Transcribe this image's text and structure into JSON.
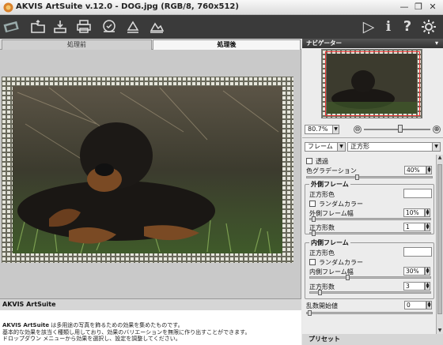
{
  "window": {
    "title": "AKVIS ArtSuite v.12.0 - DOG.jpg (RGB/8, 760x512)",
    "minimize_glyph": "—",
    "restore_glyph": "❐",
    "close_glyph": "✕"
  },
  "toolbar": {
    "icons": [
      "open-icon",
      "save-icon",
      "print-icon",
      "share-icon",
      "batch-icon",
      "settings-extra-icon",
      "run-icon",
      "info-icon",
      "help-icon",
      "preferences-icon"
    ],
    "run_glyph": "▷",
    "info_glyph": "i",
    "help_glyph": "?"
  },
  "tabs": {
    "before_label": "処理前",
    "after_label": "処理後"
  },
  "help": {
    "heading": "AKVIS ArtSuite",
    "strong": "AKVIS ArtSuite",
    "line1_rest": " は多用途の写真を飾るための効果を集めたものです。",
    "line2": "基本的な効果を該当く種類し用しており、効果のバリエーションを無限に作り出すことができます。",
    "line3": "ドロップダウン メニューから効果を選択し、設定を調整してください。"
  },
  "navigator": {
    "heading": "ナビゲーター",
    "zoom": "80.7%",
    "zoom_minus": "⊖",
    "zoom_plus": "⊕",
    "zoom_level": 0.55
  },
  "effect": {
    "category": "フレーム",
    "type": "正方形"
  },
  "settings": {
    "transparency_label": "透過",
    "transparency_checked": false,
    "gradation_label": "色グラデーション",
    "gradation_value": "40%",
    "outer": {
      "title": "外側フレーム",
      "square_color_label": "正方形色",
      "random_color_label": "ランダムカラー",
      "frame_width_label": "外側フレーム幅",
      "frame_width_value": "10%",
      "square_count_label": "正方形数",
      "square_count_value": "1"
    },
    "inner": {
      "title": "内側フレーム",
      "square_color_label": "正方形色",
      "random_color_label": "ランダムカラー",
      "frame_width_label": "内側フレーム幅",
      "frame_width_value": "30%",
      "square_count_label": "正方形数",
      "square_count_value": "3"
    },
    "seed_label": "乱数開始値",
    "seed_value": "0"
  },
  "presets": {
    "heading": "プリセット"
  },
  "colors": {
    "toolbar_bg": "#3a3a3a",
    "panel_header": "#444444",
    "zoom_box": "#e33333"
  }
}
